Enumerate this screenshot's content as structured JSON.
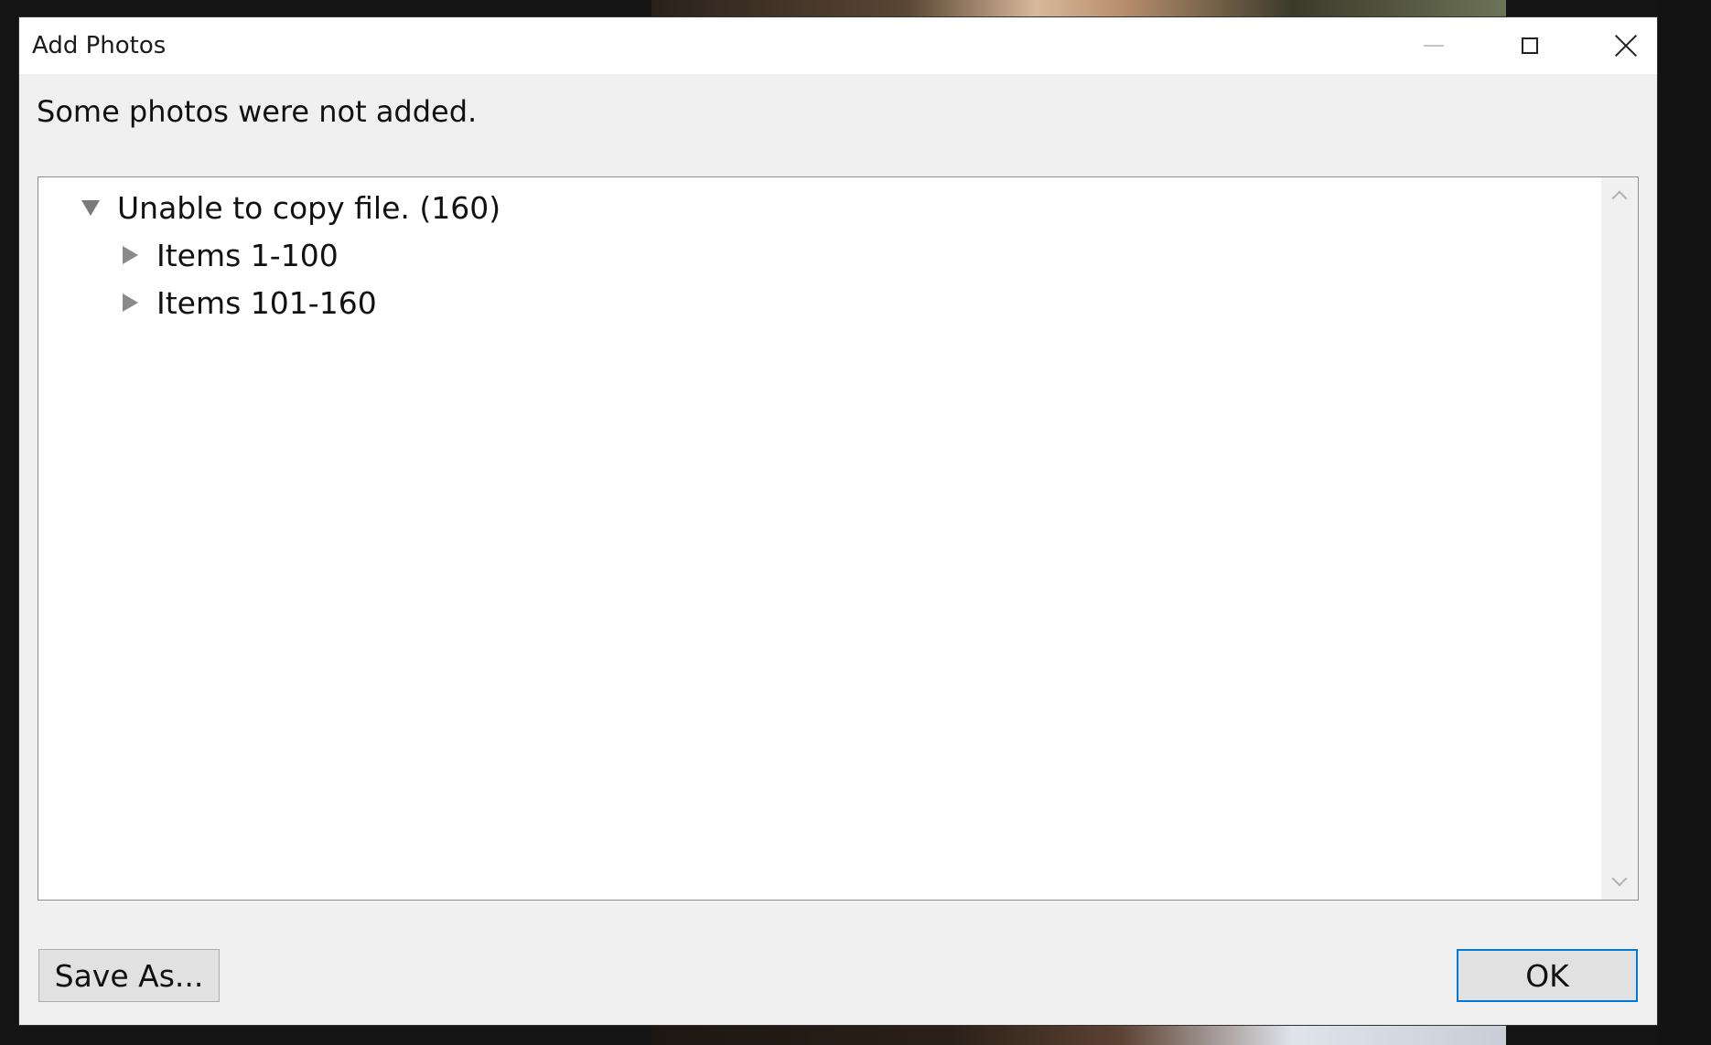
{
  "window": {
    "title": "Add Photos"
  },
  "message": "Some photos were not added.",
  "tree": {
    "root": {
      "label": "Unable to copy file. (160)",
      "expanded": true
    },
    "children": [
      {
        "label": "Items 1-100",
        "expanded": false
      },
      {
        "label": "Items 101-160",
        "expanded": false
      }
    ]
  },
  "buttons": {
    "save_as": "Save As...",
    "ok": "OK"
  },
  "icons": {
    "minimize": "minimize-icon",
    "maximize": "maximize-icon",
    "close": "close-icon",
    "expanded": "triangle-down-icon",
    "collapsed": "triangle-right-icon"
  },
  "colors": {
    "accent_focus": "#0078d7",
    "dialog_bg": "#f0f0f0",
    "titlebar_bg": "#ffffff"
  }
}
